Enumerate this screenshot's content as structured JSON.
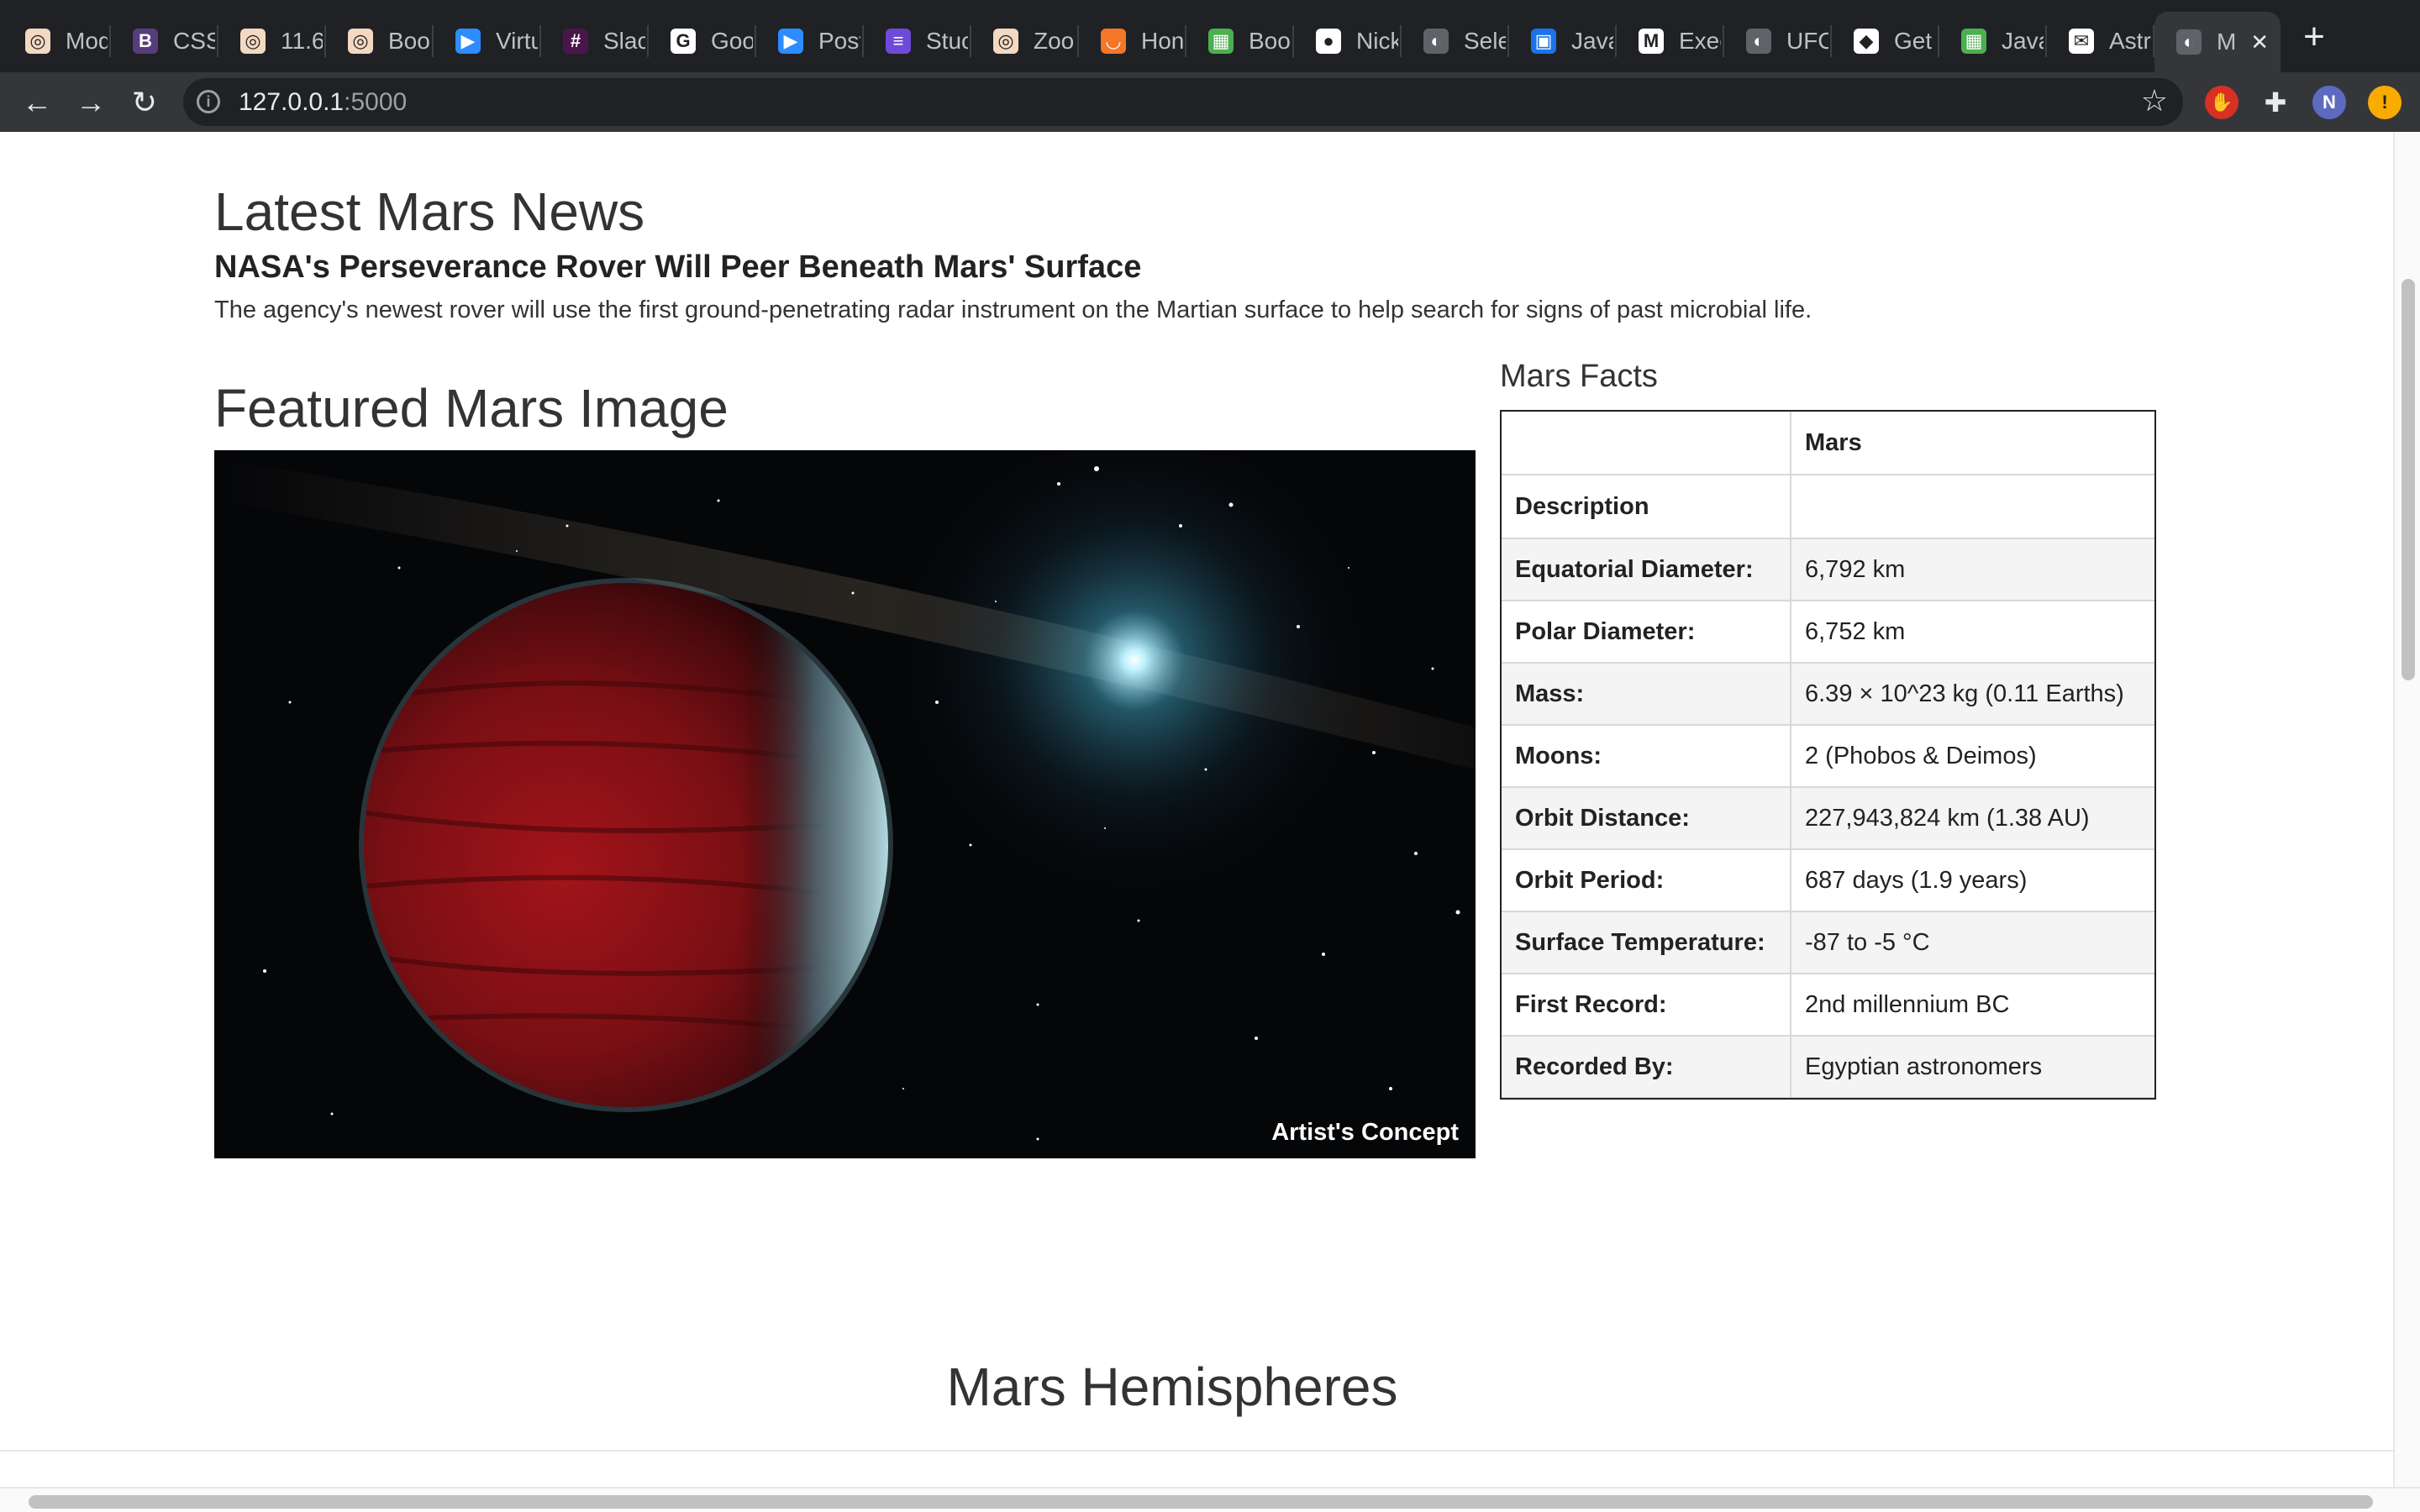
{
  "browser": {
    "tabs": [
      {
        "title": "Mod",
        "icon": "circle-logo-icon",
        "color": "#f3d9c1"
      },
      {
        "title": "CSS",
        "icon": "bootstrap-icon",
        "color": "#563d7c"
      },
      {
        "title": "11.6",
        "icon": "circle-logo-icon",
        "color": "#f3d9c1"
      },
      {
        "title": "Boo",
        "icon": "circle-logo-icon",
        "color": "#f3d9c1"
      },
      {
        "title": "Virtu",
        "icon": "zoom-icon",
        "color": "#2d8cff"
      },
      {
        "title": "Slac",
        "icon": "slack-icon",
        "color": "#4a154b"
      },
      {
        "title": "Goo",
        "icon": "google-icon",
        "color": "#ffffff"
      },
      {
        "title": "Post",
        "icon": "zoom-icon",
        "color": "#2d8cff"
      },
      {
        "title": "Stuc",
        "icon": "list-icon",
        "color": "#6e4ad8"
      },
      {
        "title": "Zoo",
        "icon": "circle-logo-icon",
        "color": "#f3d9c1"
      },
      {
        "title": "Hon",
        "icon": "jupyter-icon",
        "color": "#f37726"
      },
      {
        "title": "Boo",
        "icon": "grid-icon",
        "color": "#4caf50"
      },
      {
        "title": "Nick",
        "icon": "github-icon",
        "color": "#ffffff"
      },
      {
        "title": "Sele",
        "icon": "globe-icon",
        "color": "#5f6368"
      },
      {
        "title": "Java",
        "icon": "image-icon",
        "color": "#1a73e8"
      },
      {
        "title": "Exec",
        "icon": "medium-icon",
        "color": "#ffffff"
      },
      {
        "title": "UFO",
        "icon": "globe-icon",
        "color": "#5f6368"
      },
      {
        "title": "Get",
        "icon": "code-icon",
        "color": "#ffffff"
      },
      {
        "title": "Java",
        "icon": "grid-icon",
        "color": "#4caf50"
      },
      {
        "title": "Astr",
        "icon": "envelope-icon",
        "color": "#ffffff"
      },
      {
        "title": "M",
        "icon": "globe-icon",
        "color": "#5f6368"
      }
    ],
    "url_host": "127.0.0.1",
    "url_port": ":5000",
    "profile_initial": "N"
  },
  "news": {
    "section_title": "Latest Mars News",
    "headline": "NASA's Perseverance Rover Will Peer Beneath Mars' Surface",
    "teaser": "The agency's newest rover will use the first ground-penetrating radar instrument on the Martian surface to help search for signs of past microbial life."
  },
  "featured": {
    "section_title": "Featured Mars Image",
    "caption": "Artist's Concept"
  },
  "facts": {
    "section_title": "Mars Facts",
    "header": [
      "",
      "Mars"
    ],
    "rows": [
      [
        "Description",
        ""
      ],
      [
        "Equatorial Diameter:",
        "6,792 km"
      ],
      [
        "Polar Diameter:",
        "6,752 km"
      ],
      [
        "Mass:",
        "6.39 × 10^23 kg (0.11 Earths)"
      ],
      [
        "Moons:",
        "2 (Phobos & Deimos)"
      ],
      [
        "Orbit Distance:",
        "227,943,824 km (1.38 AU)"
      ],
      [
        "Orbit Period:",
        "687 days (1.9 years)"
      ],
      [
        "Surface Temperature:",
        "-87 to -5 °C"
      ],
      [
        "First Record:",
        "2nd millennium BC"
      ],
      [
        "Recorded By:",
        "Egyptian astronomers"
      ]
    ]
  },
  "hemispheres": {
    "section_title": "Mars Hemispheres"
  }
}
